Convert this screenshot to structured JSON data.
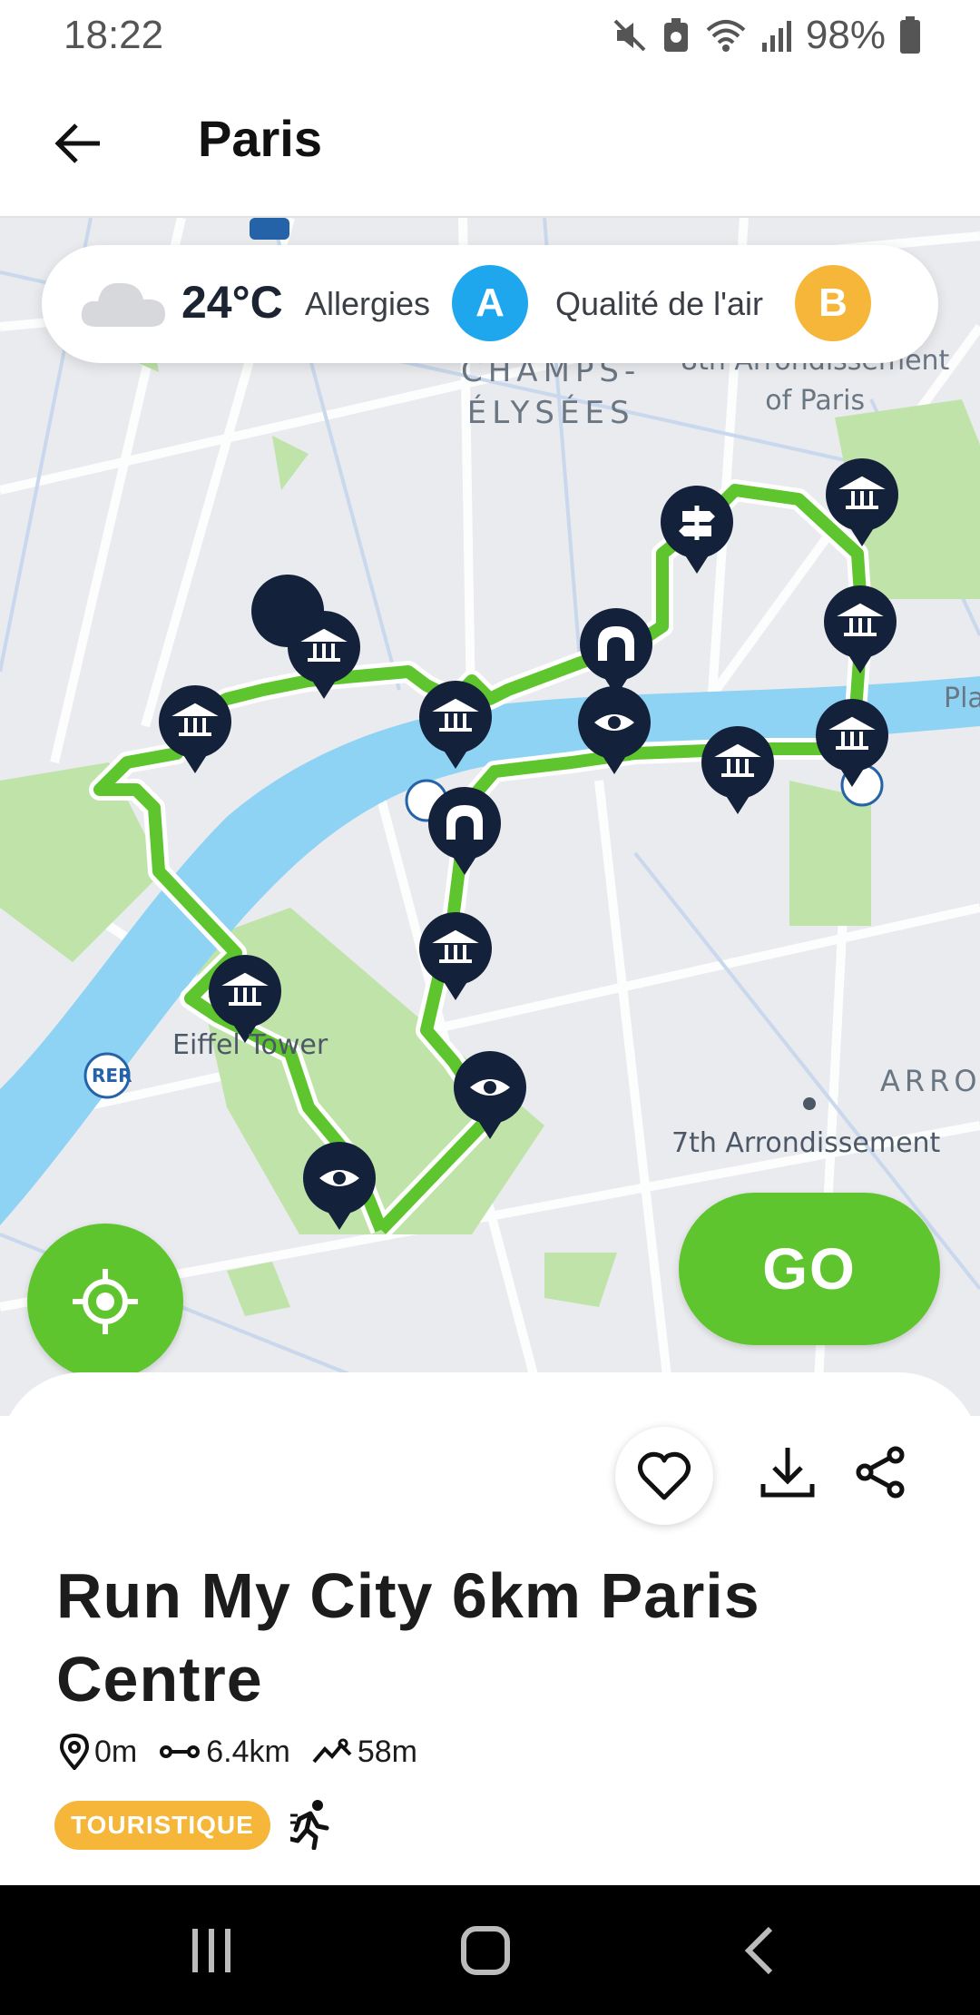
{
  "status_bar": {
    "time": "18:22",
    "battery": "98%",
    "icons": [
      "mute-icon",
      "battery-saver-icon",
      "wifi-icon",
      "signal-icon",
      "battery-icon"
    ]
  },
  "app_bar": {
    "title": "Paris",
    "back_icon": "arrow-left-icon"
  },
  "weather": {
    "icon": "cloud-icon",
    "temperature": "24°C",
    "allergies_label": "Allergies",
    "allergies_grade": "A",
    "air_quality_label": "Qualité de l'air",
    "air_quality_grade": "B",
    "colors": {
      "grade_a": "#1fa7ee",
      "grade_b": "#f5b63a"
    }
  },
  "map": {
    "labels": {
      "champs_line1": "CHAMPS-",
      "champs_line2": "ÉLYSÉES",
      "arr8_line1": "8th Arrondissement",
      "arr8_line2": "of Paris",
      "eiffel": "Eiffel Tower",
      "arro": "ARRO",
      "arr7": "7th Arrondissement",
      "pla": "Pla",
      "rer": "RER"
    },
    "colors": {
      "route": "#5fc52e",
      "river": "#8fd3f4",
      "park": "#bfe3a8",
      "pin": "#13213a"
    },
    "markers": [
      "museum-pin",
      "museum-pin",
      "museum-pin",
      "signpost-pin",
      "museum-pin",
      "museum-pin",
      "monument-pin",
      "viewpoint-pin",
      "museum-pin",
      "museum-pin",
      "monument-pin",
      "museum-pin",
      "viewpoint-pin",
      "museum-pin",
      "viewpoint-pin"
    ]
  },
  "controls": {
    "locate_icon": "crosshair-icon",
    "go_label": "GO",
    "accent": "#5fc52e"
  },
  "route": {
    "title": "Run My City 6km Paris Centre",
    "start_distance": "0m",
    "length": "6.4km",
    "elevation": "58m",
    "tag": "TOURISTIQUE",
    "activity_icon": "runner-icon",
    "tag_color": "#f5b63a"
  },
  "nav_bar": {
    "recents_icon": "recents-icon",
    "home_icon": "home-icon",
    "back_icon": "back-chevron-icon"
  }
}
